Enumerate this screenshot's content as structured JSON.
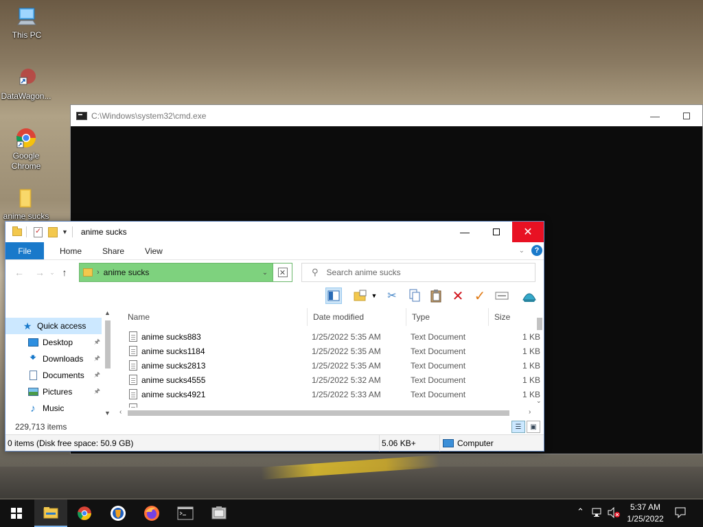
{
  "desktop": {
    "icons": [
      {
        "label": "This PC",
        "icon": "this-pc-icon"
      },
      {
        "label": "DataWagon...",
        "icon": "datawagon-icon"
      },
      {
        "label": "Google Chrome",
        "icon": "chrome-icon"
      },
      {
        "label": "anime sucks",
        "icon": "folder-icon"
      }
    ]
  },
  "cmd": {
    "title": "C:\\Windows\\system32\\cmd.exe"
  },
  "explorer": {
    "title": "anime sucks",
    "tabs": {
      "file": "File",
      "home": "Home",
      "share": "Share",
      "view": "View"
    },
    "help": "?",
    "address": {
      "path": "anime sucks"
    },
    "search": {
      "placeholder": "Search anime sucks"
    },
    "columns": {
      "name": "Name",
      "date": "Date modified",
      "type": "Type",
      "size": "Size"
    },
    "nav": [
      {
        "label": "Quick access",
        "pinned": false
      },
      {
        "label": "Desktop",
        "pinned": true
      },
      {
        "label": "Downloads",
        "pinned": true
      },
      {
        "label": "Documents",
        "pinned": true
      },
      {
        "label": "Pictures",
        "pinned": true
      },
      {
        "label": "Music",
        "pinned": false
      }
    ],
    "files": [
      {
        "name": "anime sucks883",
        "date": "1/25/2022 5:35 AM",
        "type": "Text Document",
        "size": "1 KB"
      },
      {
        "name": "anime sucks1184",
        "date": "1/25/2022 5:35 AM",
        "type": "Text Document",
        "size": "1 KB"
      },
      {
        "name": "anime sucks2813",
        "date": "1/25/2022 5:35 AM",
        "type": "Text Document",
        "size": "1 KB"
      },
      {
        "name": "anime sucks4555",
        "date": "1/25/2022 5:32 AM",
        "type": "Text Document",
        "size": "1 KB"
      },
      {
        "name": "anime sucks4921",
        "date": "1/25/2022 5:33 AM",
        "type": "Text Document",
        "size": "1 KB"
      }
    ],
    "status": {
      "item_count": "229,713 items",
      "selection": "0 items (Disk free space: 50.9 GB)",
      "size": "5.06 KB+",
      "location": "Computer"
    }
  },
  "taskbar": {
    "apps": [
      "start-button",
      "file-explorer",
      "chrome",
      "brave",
      "firefox",
      "cmd",
      "other-app"
    ],
    "clock": {
      "time": "5:37 AM",
      "date": "1/25/2022"
    }
  }
}
